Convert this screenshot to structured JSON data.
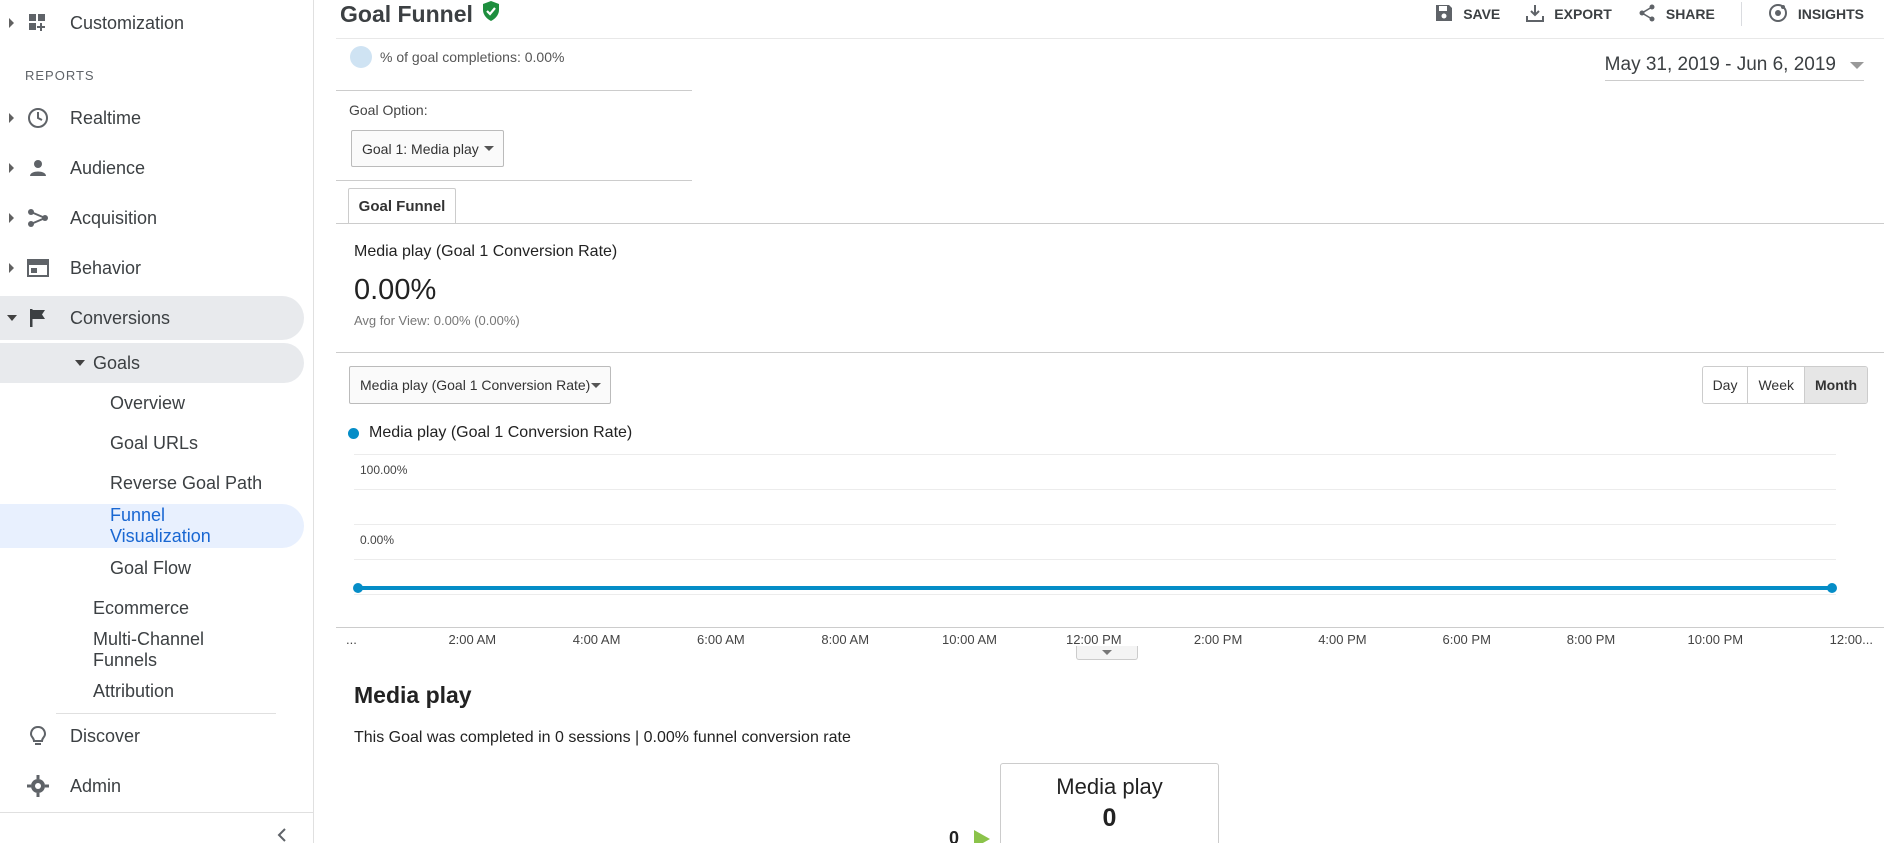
{
  "sidebar": {
    "customization": "Customization",
    "reports_header": "REPORTS",
    "realtime": "Realtime",
    "audience": "Audience",
    "acquisition": "Acquisition",
    "behavior": "Behavior",
    "conversions": "Conversions",
    "goals": "Goals",
    "goals_items": [
      "Overview",
      "Goal URLs",
      "Reverse Goal Path",
      "Funnel Visualization",
      "Goal Flow"
    ],
    "funnel_vis_line1": "Funnel",
    "funnel_vis_line2": "Visualization",
    "ecommerce": "Ecommerce",
    "multichannel_line1": "Multi-Channel",
    "multichannel_line2": "Funnels",
    "attribution": "Attribution",
    "discover": "Discover",
    "admin": "Admin"
  },
  "header": {
    "title": "Goal Funnel",
    "save": "SAVE",
    "export": "EXPORT",
    "share": "SHARE",
    "insights": "INSIGHTS"
  },
  "summary": {
    "pct_completions": "% of goal completions: 0.00%",
    "date_range": "May 31, 2019 - Jun 6, 2019"
  },
  "goal_option": {
    "label": "Goal Option:",
    "selected": "Goal 1: Media play"
  },
  "tabs": {
    "goal_funnel": "Goal Funnel"
  },
  "metric": {
    "title": "Media play (Goal 1 Conversion Rate)",
    "value": "0.00%",
    "avg": "Avg for View: 0.00% (0.00%)"
  },
  "metric_select": {
    "selected": "Media play (Goal 1 Conversion Rate)"
  },
  "period": {
    "day": "Day",
    "week": "Week",
    "month": "Month",
    "active": "Month"
  },
  "legend": {
    "label": "Media play (Goal 1 Conversion Rate)"
  },
  "colors": {
    "series": "#058dc7",
    "accent": "#1967d2",
    "verified": "#1e8e3e"
  },
  "chart_data": {
    "type": "line",
    "series": [
      {
        "name": "Media play (Goal 1 Conversion Rate)",
        "values": [
          0,
          0
        ]
      }
    ],
    "y_ticks": [
      "100.00%",
      "0.00%"
    ],
    "x_ticks": [
      "...",
      "2:00 AM",
      "4:00 AM",
      "6:00 AM",
      "8:00 AM",
      "10:00 AM",
      "12:00 PM",
      "2:00 PM",
      "4:00 PM",
      "6:00 PM",
      "8:00 PM",
      "10:00 PM",
      "12:00..."
    ],
    "ylim": [
      0,
      100
    ]
  },
  "funnel": {
    "title": "Media play",
    "description": "This Goal was completed in 0 sessions | 0.00% funnel conversion rate",
    "step_label": "Media play",
    "step_value": "0",
    "entrance_value": "0"
  }
}
